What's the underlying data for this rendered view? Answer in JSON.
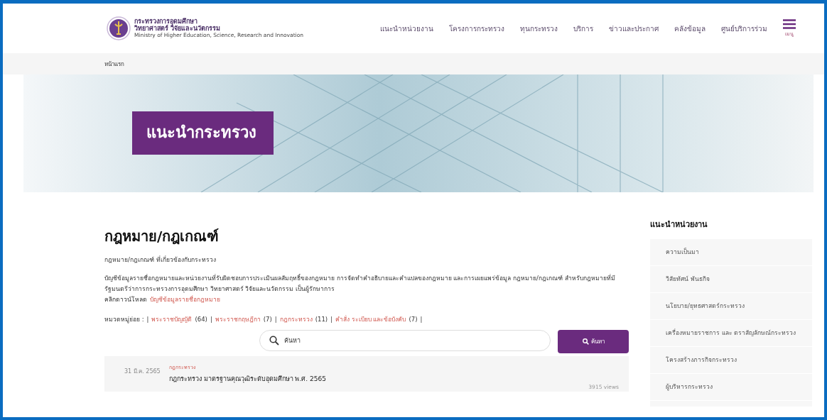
{
  "header": {
    "logo_lines": [
      "กระทรวงการอุดมศึกษา",
      "วิทยาศาสตร์ วิจัยและนวัตกรรม",
      "Ministry of Higher Education, Science, Research and Innovation"
    ],
    "nav": [
      "แนะนำหน่วยงาน",
      "โครงการกระทรวง",
      "ทุนกระทรวง",
      "บริการ",
      "ข่าวและประกาศ",
      "คลังข้อมูล",
      "ศูนย์บริการร่วม"
    ],
    "menu_label": "เมนู"
  },
  "breadcrumb": [
    "หน้าแรก"
  ],
  "hero": {
    "title": "แนะนำกระทรวง"
  },
  "main": {
    "title": "กฎหมาย/กฎเกณฑ์",
    "subtitle": "กฎหมาย/กฎเกณฑ์ ที่เกี่ยวข้องกับกระทรวง",
    "description": "บัญชีข้อมูลรายชื่อกฎหมายและหน่วยงานที่รับผิดชอบการประเมินผลสัมฤทธิ์ของกฎหมาย การจัดทำคำอธิบายและคำแปลของกฎหมาย และการเผยแพร่ข้อมูล กฎหมาย/กฎเกณฑ์ สำหรับกฎหมายที่มีรัฐมนตรีว่าการกระทรวงการอุดมศึกษา วิทยาศาสตร์ วิจัยและนวัตกรรม เป็นผู้รักษาการ",
    "download_prefix": "คลิกดาวน์โหลด",
    "download_link": "บัญชีข้อมูลรายชื่อกฎหมาย",
    "categories_label": "หมวดหมู่ย่อย :",
    "separator": "|",
    "categories": [
      {
        "label": "พระราชบัญญัติ",
        "count": "(64)"
      },
      {
        "label": "พระราชกฤษฎีกา",
        "count": "(7)"
      },
      {
        "label": "กฎกระทรวง",
        "count": "(11)"
      },
      {
        "label": "คำสั่ง ระเบียบ และข้อบังคับ",
        "count": "(7)"
      }
    ],
    "search": {
      "placeholder": "ค้นหา",
      "button": "ค้นหา"
    },
    "entries": [
      {
        "date": "31 มี.ค. 2565",
        "tag": "กฎกระทรวง",
        "title": "กฎกระทรวง มาตรฐานคุณวุฒิระดับอุดมศึกษา พ.ศ. 2565",
        "views": "3915 views"
      }
    ]
  },
  "sidebar": {
    "title": "แนะนำหน่วยงาน",
    "items": [
      "ความเป็นมา",
      "วิสัยทัศน์ พันธกิจ",
      "นโยบาย/ยุทธศาสตร์กระทรวง",
      "เครื่องหมายราชการ และ ตราสัญลักษณ์กระทรวง",
      "โครงสร้างภารกิจกระทรวง",
      "ผู้บริหารกระทรวง"
    ]
  }
}
